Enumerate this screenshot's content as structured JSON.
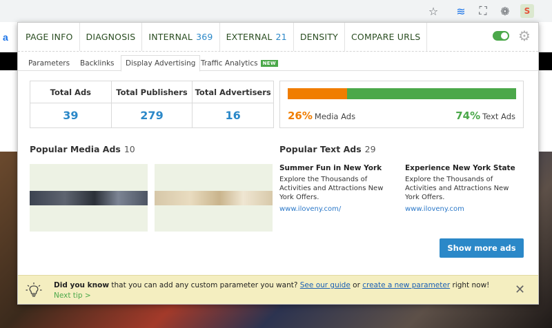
{
  "topnav": {
    "items": [
      {
        "label": "PAGE INFO",
        "count": ""
      },
      {
        "label": "DIAGNOSIS",
        "count": ""
      },
      {
        "label": "INTERNAL",
        "count": "369"
      },
      {
        "label": "EXTERNAL",
        "count": "21"
      },
      {
        "label": "DENSITY",
        "count": ""
      },
      {
        "label": "COMPARE URLS",
        "count": ""
      }
    ],
    "toggle_on": true
  },
  "subtabs": {
    "parameters": "Parameters",
    "backlinks": "Backlinks",
    "display_advertising": "Display Advertising",
    "traffic_analytics": "Traffic Analytics",
    "new_badge": "NEW"
  },
  "stats": {
    "total_ads_label": "Total Ads",
    "total_ads": "39",
    "total_publishers_label": "Total Publishers",
    "total_publishers": "279",
    "total_advertisers_label": "Total Advertisers",
    "total_advertisers": "16"
  },
  "ratio": {
    "media_pct": "26%",
    "media_label": "Media Ads",
    "text_pct": "74%",
    "text_label": "Text Ads",
    "media_fraction": 0.26
  },
  "media_ads": {
    "title": "Popular Media Ads",
    "count": "10"
  },
  "text_ads": {
    "title": "Popular Text Ads",
    "count": "29",
    "items": [
      {
        "title": "Summer Fun in New York",
        "body": "Explore the Thousands of Activities and Attractions New York Offers.",
        "url": "www.iloveny.com/"
      },
      {
        "title": "Experience New York State",
        "body": "Explore the Thousands of Activities and Attractions New York Offers.",
        "url": "www.iloveny.com"
      }
    ]
  },
  "show_more": "Show more ads",
  "tip": {
    "lead": "Did you know",
    "text1": "that you can add any custom parameter you want?",
    "link1": "See our guide",
    "or": "or",
    "link2": "create a new parameter",
    "text2": "right now!",
    "next": "Next tip >"
  },
  "colors": {
    "accent_blue": "#2b88c8",
    "green": "#4ba84a",
    "orange": "#f07d00",
    "tip_bg": "#f4eec0"
  }
}
